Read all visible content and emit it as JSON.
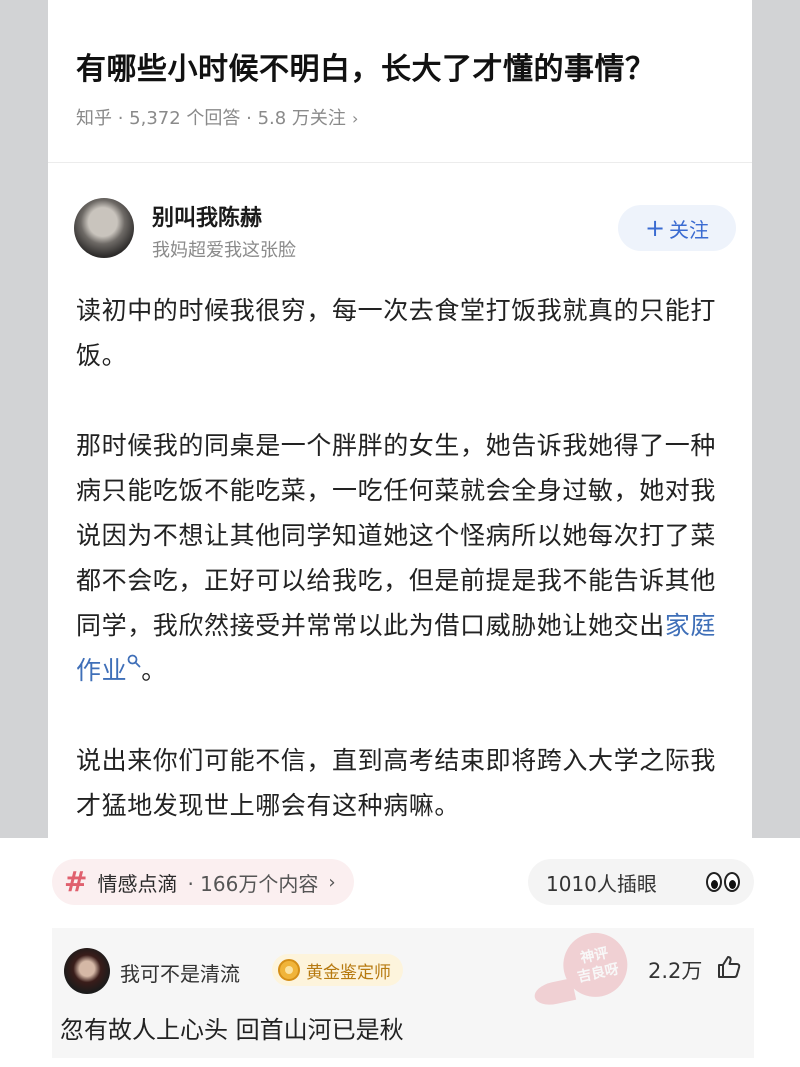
{
  "question": {
    "title": "有哪些小时候不明白，长大了才懂的事情？",
    "meta": "知乎 · 5,372 个回答 · 5.8 万关注",
    "meta_chevron": "›"
  },
  "author": {
    "name": "别叫我陈赫",
    "bio": "我妈超爱我这张脸",
    "follow_plus": "+",
    "follow_label": "关注"
  },
  "answer": {
    "p1": "读初中的时候我很穷，每一次去食堂打饭我就真的只能打饭。",
    "p2_before_link": "那时候我的同桌是一个胖胖的女生，她告诉我她得了一种病只能吃饭不能吃菜，一吃任何菜就会全身过敏，她对我说因为不想让其他同学知道她这个怪病所以她每次打了菜都不会吃，正好可以给我吃，但是前提是我不能告诉其他同学，我欣然接受并常常以此为借口威胁她让她交出",
    "p2_link": "家庭作业",
    "p2_after_link": "。",
    "p3": "说出来你们可能不信，直到高考结束即将跨入大学之际我才猛地发现世上哪会有这种病嘛。"
  },
  "tag": {
    "symbol": "#",
    "name": "情感点滴",
    "count": "· 166万个内容",
    "chevron": "›"
  },
  "reactions": {
    "label": "1010人插眼",
    "icon": "peeking-eyes-icon"
  },
  "comment": {
    "user": "我可不是清流",
    "badge": "黄金鉴定师",
    "text": "忽有故人上心头 回首山河已是秋",
    "likes": "2.2万",
    "like_icon": "thumbs-up-icon"
  },
  "watermark": {
    "line1": "神评",
    "line2": "吉良呀"
  },
  "colors": {
    "link": "#3f6fb8",
    "follow_text": "#3a6bd1",
    "tag_hash": "#e0606e",
    "badge_text": "#b77a10"
  }
}
